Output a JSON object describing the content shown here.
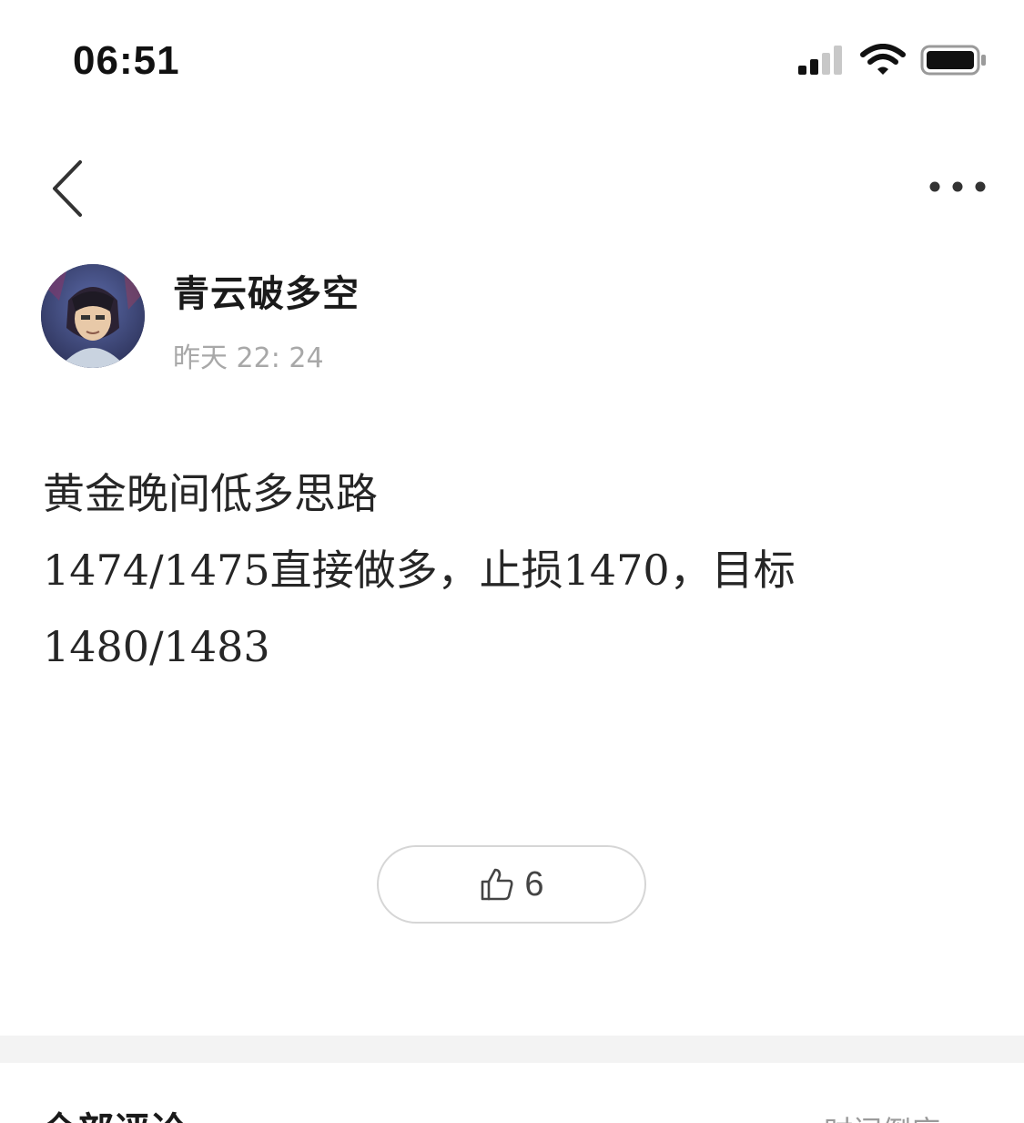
{
  "status_bar": {
    "time": "06:51",
    "icons": [
      "signal-icon",
      "wifi-icon",
      "battery-icon"
    ]
  },
  "nav": {
    "back_icon": "chevron-left-icon",
    "more_icon": "more-dots-icon"
  },
  "author": {
    "name": "青云破多空",
    "post_time": "昨天 22: 24"
  },
  "post": {
    "lines": [
      "黄金晚间低多思路",
      "1474/1475直接做多，止损1470，目标",
      "1480/1483"
    ]
  },
  "like": {
    "icon": "thumbs-up-icon",
    "count": "6"
  },
  "comments": {
    "title": "全部评论",
    "sort_label": "时间倒序"
  },
  "colors": {
    "background": "#ffffff",
    "text_primary": "#222222",
    "text_secondary": "#a8a8a8",
    "divider": "#f3f3f3",
    "button_border": "#d6d6d6"
  }
}
